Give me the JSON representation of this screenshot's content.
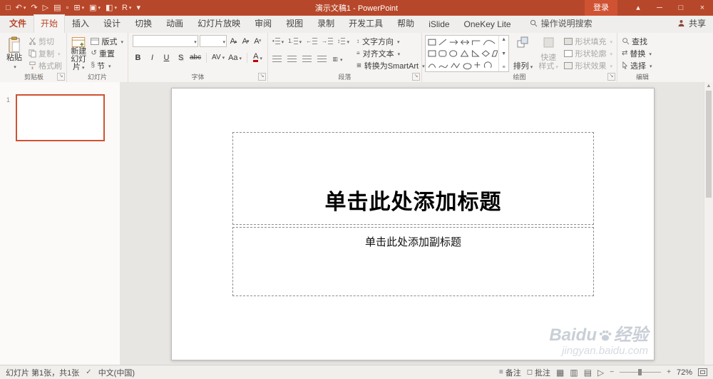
{
  "titlebar": {
    "title": "演示文稿1 - PowerPoint",
    "signin": "登录",
    "qat": [
      {
        "name": "save",
        "glyph": "□"
      },
      {
        "name": "undo",
        "glyph": "↶"
      },
      {
        "name": "redo",
        "glyph": "↷"
      },
      {
        "name": "start-slideshow",
        "glyph": "▷"
      },
      {
        "name": "print-preview",
        "glyph": "▤"
      },
      {
        "name": "new-file",
        "glyph": "▫"
      },
      {
        "name": "insert-table",
        "glyph": "⊞"
      },
      {
        "name": "insert-picture",
        "glyph": "▣"
      },
      {
        "name": "fill-color",
        "glyph": "◧"
      },
      {
        "name": "r-tool",
        "glyph": "R"
      },
      {
        "name": "customize-qat",
        "glyph": "▾"
      }
    ],
    "window": {
      "ribbon_options": "▴",
      "minimize": "─",
      "restore": "□",
      "close": "×"
    }
  },
  "tabs": [
    "文件",
    "开始",
    "插入",
    "设计",
    "切换",
    "动画",
    "幻灯片放映",
    "审阅",
    "视图",
    "录制",
    "开发工具",
    "帮助",
    "iSlide",
    "OneKey Lite"
  ],
  "tellme": "操作说明搜索",
  "share": "共享",
  "ribbon": {
    "clipboard": {
      "label": "剪贴板",
      "paste": "粘贴",
      "cut": "剪切",
      "copy": "复制",
      "format_painter": "格式刷"
    },
    "slides": {
      "label": "幻灯片",
      "new_slide": "新建幻灯片",
      "layout": "版式",
      "reset": "重置",
      "section": "节"
    },
    "font": {
      "label": "字体",
      "name_value": "",
      "size_value": "",
      "bold": "B",
      "italic": "I",
      "underline": "U",
      "shadow": "S",
      "strike": "abc",
      "spacing": "AV",
      "case": "Aa",
      "color": "A",
      "grow": "A",
      "shrink": "A",
      "clear": "A"
    },
    "paragraph": {
      "label": "段落",
      "text_direction": "文字方向",
      "align_text": "对齐文本",
      "smartart": "转换为SmartArt"
    },
    "drawing": {
      "label": "绘图",
      "arrange": "排列",
      "quick_styles": "快速样式",
      "shape_fill": "形状填充",
      "shape_outline": "形状轮廓",
      "shape_effects": "形状效果"
    },
    "editing": {
      "label": "编辑",
      "find": "查找",
      "replace": "替换",
      "select": "选择"
    }
  },
  "icons": {
    "reset": "↺",
    "section": "§",
    "replace": "⇄",
    "bullets": "•",
    "numbering": "1.",
    "indent_left": "←",
    "indent_right": "→",
    "line_spacing": "↕",
    "columns": "▥",
    "text_direction": "↕",
    "align_text": "≡",
    "smartart": "⊞",
    "notes": "≡",
    "comments": "◻",
    "spell": "✓",
    "view_normal": "▦",
    "view_sorter": "▥",
    "view_reading": "▤",
    "view_show": "▷",
    "zoom_out": "−",
    "zoom_in": "+",
    "scroll_up": "▲",
    "scroll_down": "▼"
  },
  "slidepanel": {
    "slide_number": "1"
  },
  "slide": {
    "title_placeholder": "单击此处添加标题",
    "subtitle_placeholder": "单击此处添加副标题"
  },
  "watermark": {
    "brand": "Baidu",
    "suffix": "经验",
    "url": "jingyan.baidu.com"
  },
  "statusbar": {
    "slide_info": "幻灯片 第1张，共1张",
    "language": "中文(中国)",
    "notes": "备注",
    "comments": "批注",
    "zoom": "72%"
  },
  "colors": {
    "accent": "#b7472a",
    "accent_bright": "#cf5232",
    "font_color_bar": "#c00000"
  }
}
